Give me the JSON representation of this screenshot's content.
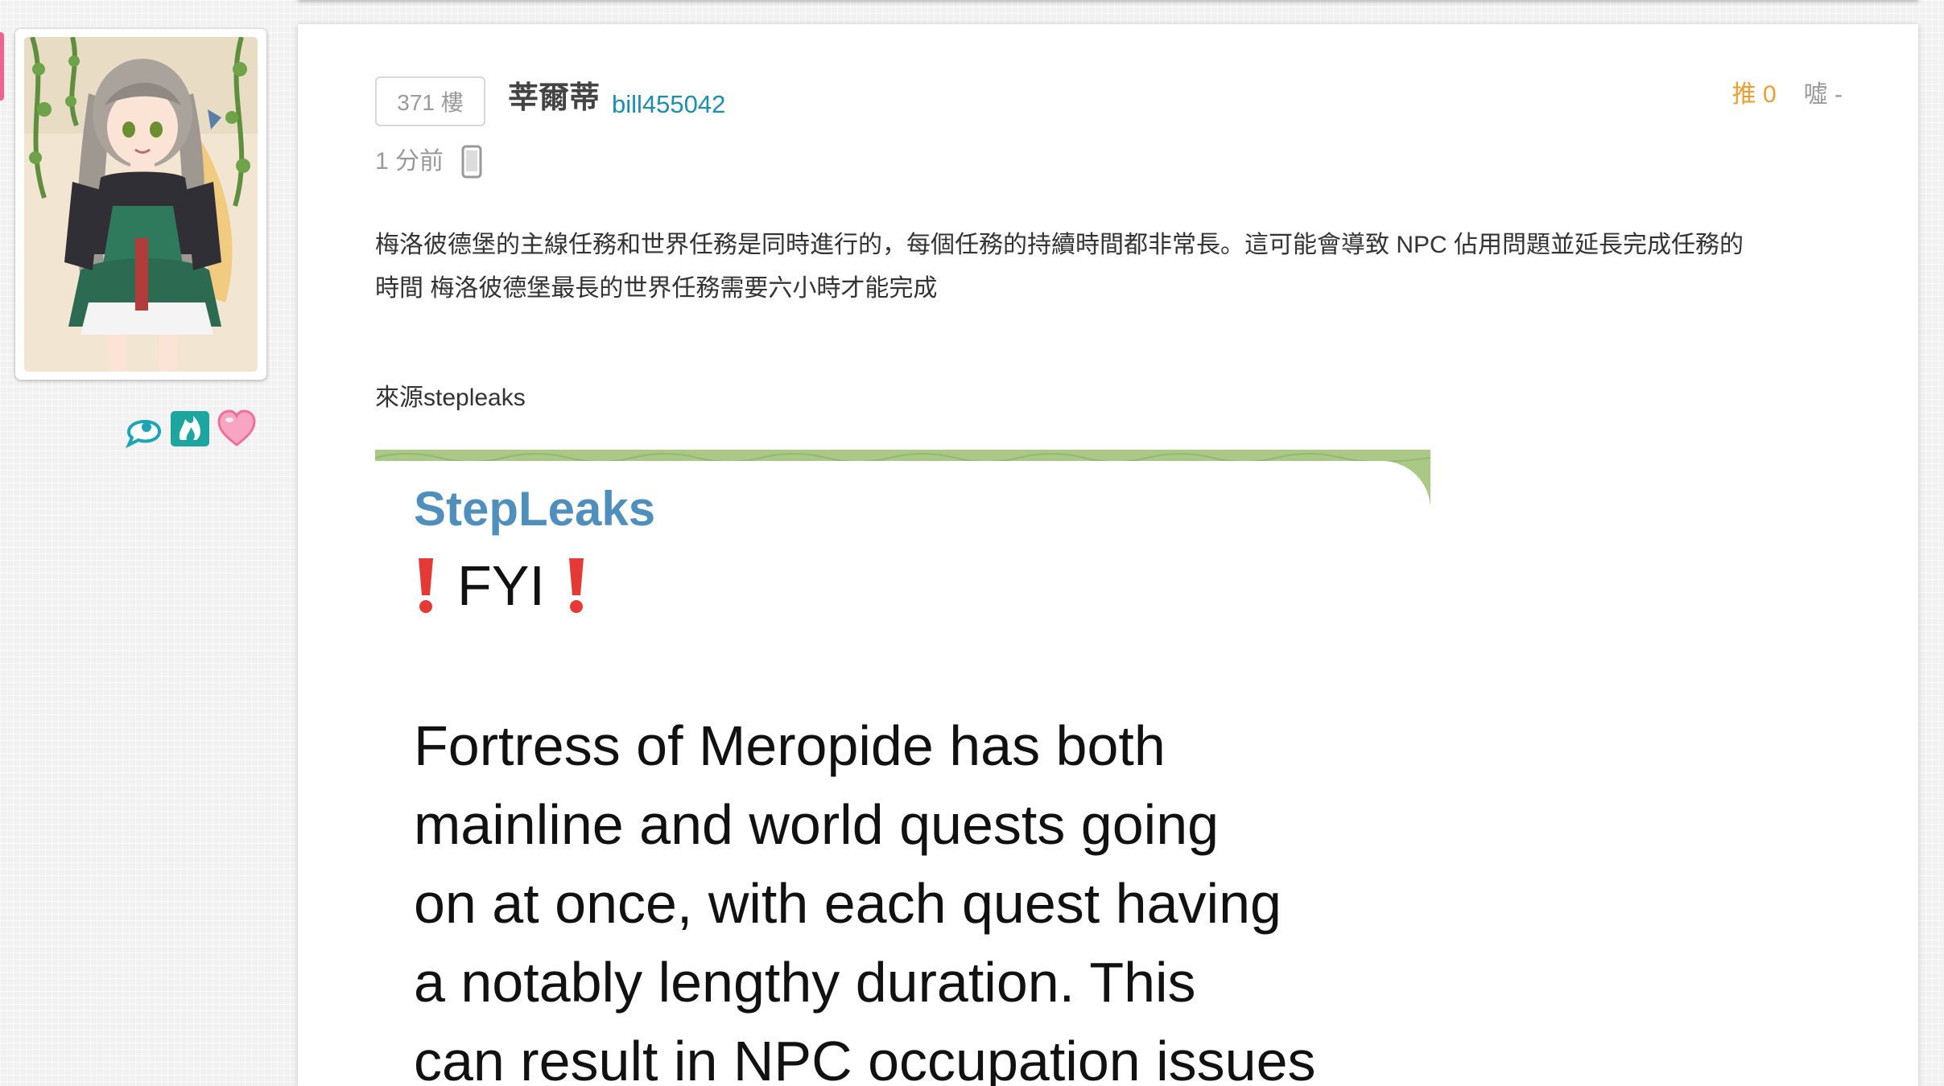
{
  "post": {
    "floor_label": "371 樓",
    "author_name": "莘爾蒂",
    "author_id": "bill455042",
    "time_ago": "1 分前",
    "device_icon": "phone-icon",
    "push_label": "推 0",
    "boo_label": "噓 -",
    "content_line1": "梅洛彼德堡的主線任務和世界任務是同時進行的，每個任務的持續時間都非常長。這可能會導致 NPC 佔用問題並延長完成任務的",
    "content_line2": "時間 梅洛彼德堡最長的世界任務需要六小時才能完成",
    "source_line": "來源stepleaks"
  },
  "sidebar": {
    "badges": [
      "chat-bubble-icon",
      "fire-badge-icon",
      "heart-icon"
    ]
  },
  "screenshot": {
    "channel": "StepLeaks",
    "fyi": "FYI",
    "lines": [
      "Fortress of Meropide has both",
      "mainline and world quests going",
      "on at once, with each quest having",
      "a notably lengthy duration. This",
      "can result in NPC occupation issues"
    ]
  },
  "colors": {
    "push": "#f39c2c",
    "author_id": "#1b8fb3",
    "channel": "#4f8fbd",
    "alert": "#e53935",
    "pink_tab": "#f06292"
  }
}
